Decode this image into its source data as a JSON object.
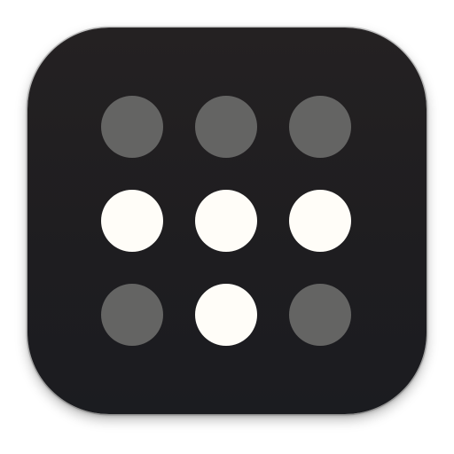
{
  "icon": {
    "name": "dot-grid-app-icon",
    "background_color": "#201f21",
    "dot_colors": {
      "lit": "#fffdf8",
      "dim": "#646463"
    }
  },
  "grid": {
    "rows": 3,
    "columns": 3,
    "dots": [
      {
        "state": "dim"
      },
      {
        "state": "dim"
      },
      {
        "state": "dim"
      },
      {
        "state": "lit"
      },
      {
        "state": "lit"
      },
      {
        "state": "lit"
      },
      {
        "state": "dim"
      },
      {
        "state": "lit"
      },
      {
        "state": "dim"
      }
    ]
  }
}
